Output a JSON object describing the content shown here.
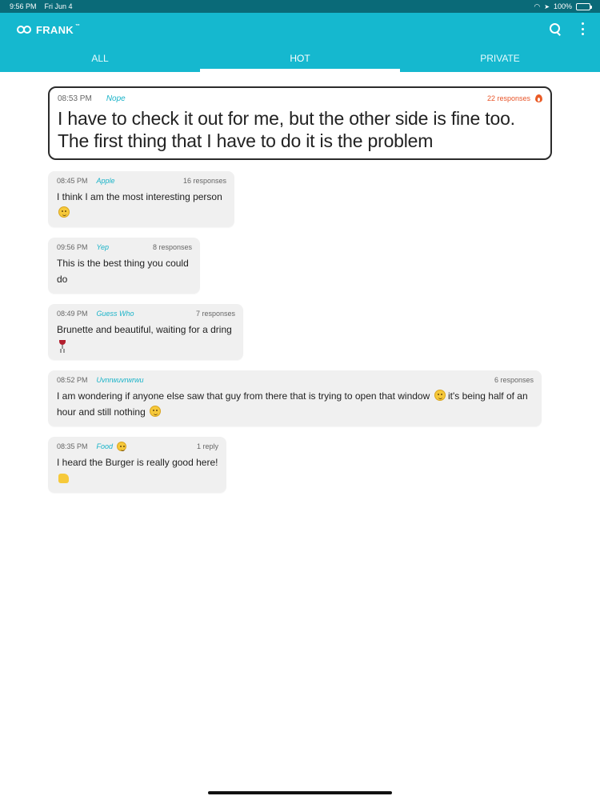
{
  "status_bar": {
    "time": "9:56 PM",
    "date": "Fri Jun 4",
    "battery": "100%"
  },
  "app": {
    "name": "FRANK",
    "tm": "™"
  },
  "tabs": [
    {
      "label": "ALL",
      "active": false
    },
    {
      "label": "HOT",
      "active": true
    },
    {
      "label": "PRIVATE",
      "active": false
    }
  ],
  "icons": {
    "search": "search-icon",
    "more": "more-vertical-icon",
    "flame": "flame-icon"
  },
  "colors": {
    "primary": "#15b8cf",
    "status_bar": "#0a6a78",
    "accent_orange": "#e8552a",
    "author": "#1ab3c8"
  },
  "hot_post": {
    "time": "08:53 PM",
    "author": "Nope",
    "responses": "22 responses",
    "text": "I have to check it out for me, but the other side is fine too. The first thing that I have to do it is the problem"
  },
  "posts": [
    {
      "time": "08:45 PM",
      "author": "Apple",
      "responses": "16 responses",
      "text": "I think I am the most interesting person",
      "emoji": "thinking-face-emoji"
    },
    {
      "time": "09:56 PM",
      "author": "Yep",
      "responses": "8 responses",
      "text": "This is the best thing you could do",
      "emoji": ""
    },
    {
      "time": "08:49 PM",
      "author": "Guess Who",
      "responses": "7 responses",
      "text": "Brunette and beautiful, waiting for a dring",
      "emoji": "wine-glass-emoji"
    },
    {
      "time": "08:52 PM",
      "author": "Uvnrwuvrwrwu",
      "responses": "6 responses",
      "text": "I am wondering if anyone else saw that guy from there that is trying to open that window",
      "text2": "it's being half of an hour and still nothing",
      "emoji": "tears-of-joy-emoji",
      "emoji2": "rofl-emoji"
    },
    {
      "time": "08:35 PM",
      "author": "Food",
      "responses": "1 reply",
      "text": "I heard the Burger is really good here!",
      "emoji": "thumbs-up-emoji",
      "author_emoji": "yum-face-emoji"
    }
  ]
}
